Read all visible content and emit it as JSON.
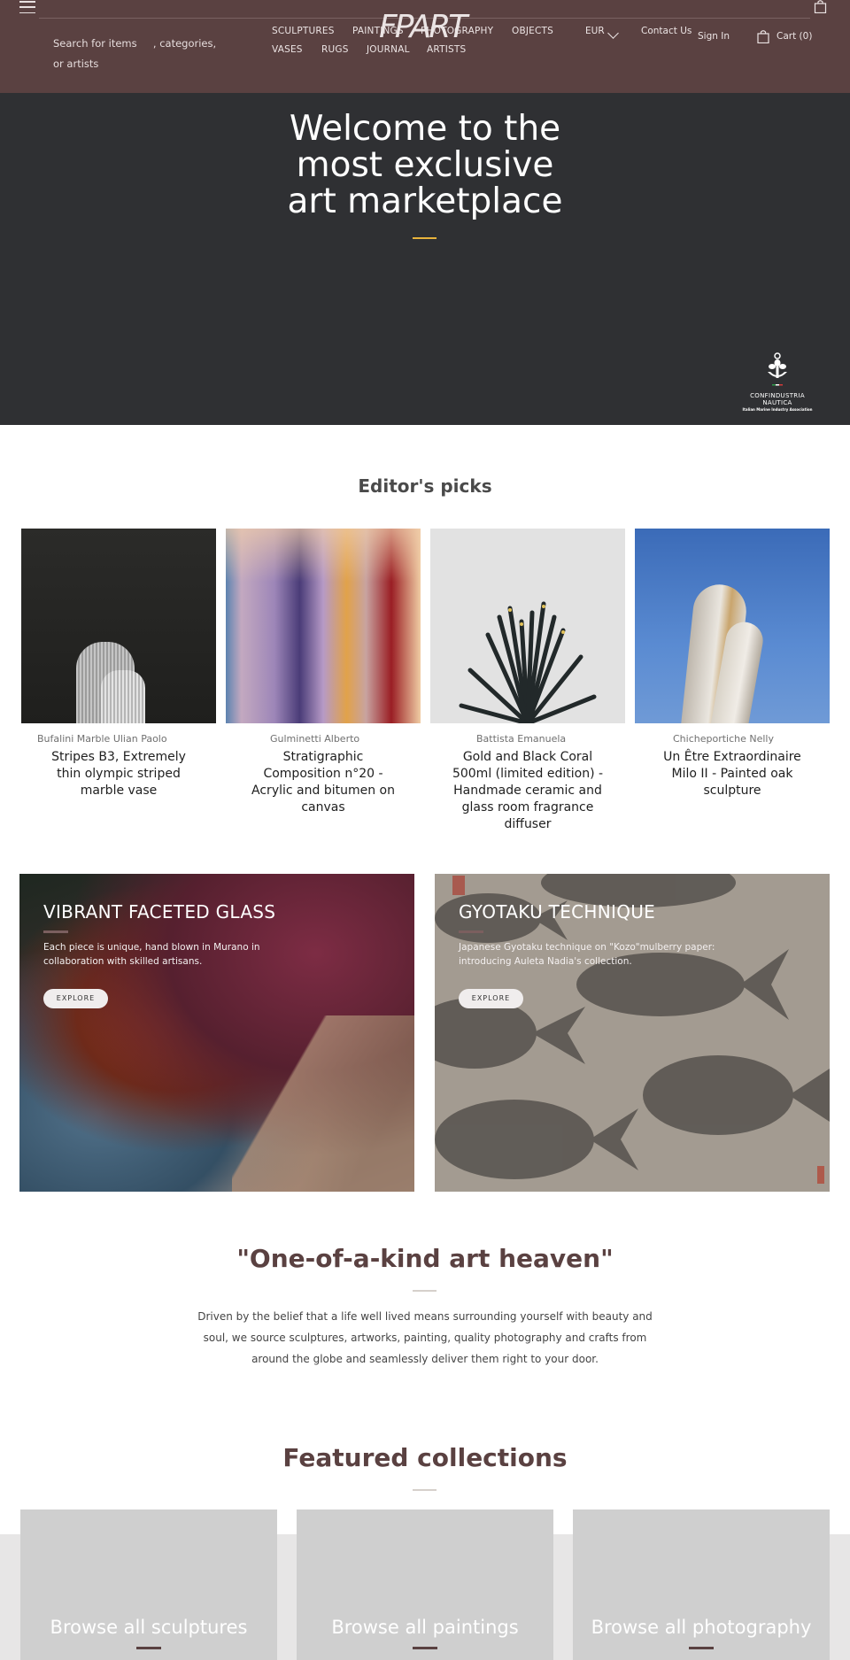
{
  "header": {
    "search_placeholder_line1": "Search for items     , categories,",
    "search_placeholder_line2": "or artists",
    "logo": "FPART",
    "nav": [
      {
        "label": "SCULPTURES"
      },
      {
        "label": "PAINTINGS"
      },
      {
        "label": "PHOTOGRAPHY"
      },
      {
        "label": "OBJECTS"
      },
      {
        "label": "VASES"
      },
      {
        "label": "RUGS"
      },
      {
        "label": "JOURNAL"
      },
      {
        "label": "ARTISTS"
      }
    ],
    "currency": "EUR",
    "contact_label": "Contact Us",
    "signin_label": "Sign In",
    "cart_label": "Cart (0)",
    "colors": {
      "header_bg": "#5a4141",
      "accent": "#e8b33c"
    }
  },
  "hero": {
    "title_lines": [
      "Welcome to the",
      "most exclusive",
      "art marketplace"
    ],
    "badge": {
      "line1": "CONFINDUSTRIA",
      "line2": "NAUTICA",
      "line3": "Italian Marine Industry Association"
    }
  },
  "editors_picks": {
    "title": "Editor's picks",
    "items": [
      {
        "artist": "Bufalini Marble Ulian Paolo",
        "name": "Stripes B3, Extremely thin olympic striped marble vase"
      },
      {
        "artist": "Gulminetti Alberto",
        "name": "Stratigraphic Composition n°20 - Acrylic and bitumen on canvas"
      },
      {
        "artist": "Battista Emanuela",
        "name": "Gold and Black Coral 500ml (limited edition) - Handmade ceramic and glass room fragrance diffuser"
      },
      {
        "artist": "Chicheportiche Nelly",
        "name": "Un Être Extraordinaire Milo II - Painted oak sculpture"
      }
    ]
  },
  "promos": [
    {
      "title": "VIBRANT FACETED GLASS",
      "description": "Each piece is unique, hand blown in Murano in collaboration with skilled artisans.",
      "button": "EXPLORE"
    },
    {
      "title": "GYOTAKU TECHNIQUE",
      "description": "Japanese Gyotaku technique on \"Kozo\"mulberry paper: introducing Auleta Nadia's collection.",
      "button": "EXPLORE"
    }
  ],
  "about": {
    "title": "\"One-of-a-kind art heaven\"",
    "text": "Driven by the belief that a life well lived means surrounding yourself with beauty and soul, we source sculptures, artworks, painting, quality photography and crafts from around the globe and seamlessly deliver them right to your door."
  },
  "featured": {
    "title": "Featured collections",
    "collections": [
      {
        "label": "Browse all sculptures"
      },
      {
        "label": "Browse all paintings"
      },
      {
        "label": "Browse all photography"
      }
    ]
  }
}
